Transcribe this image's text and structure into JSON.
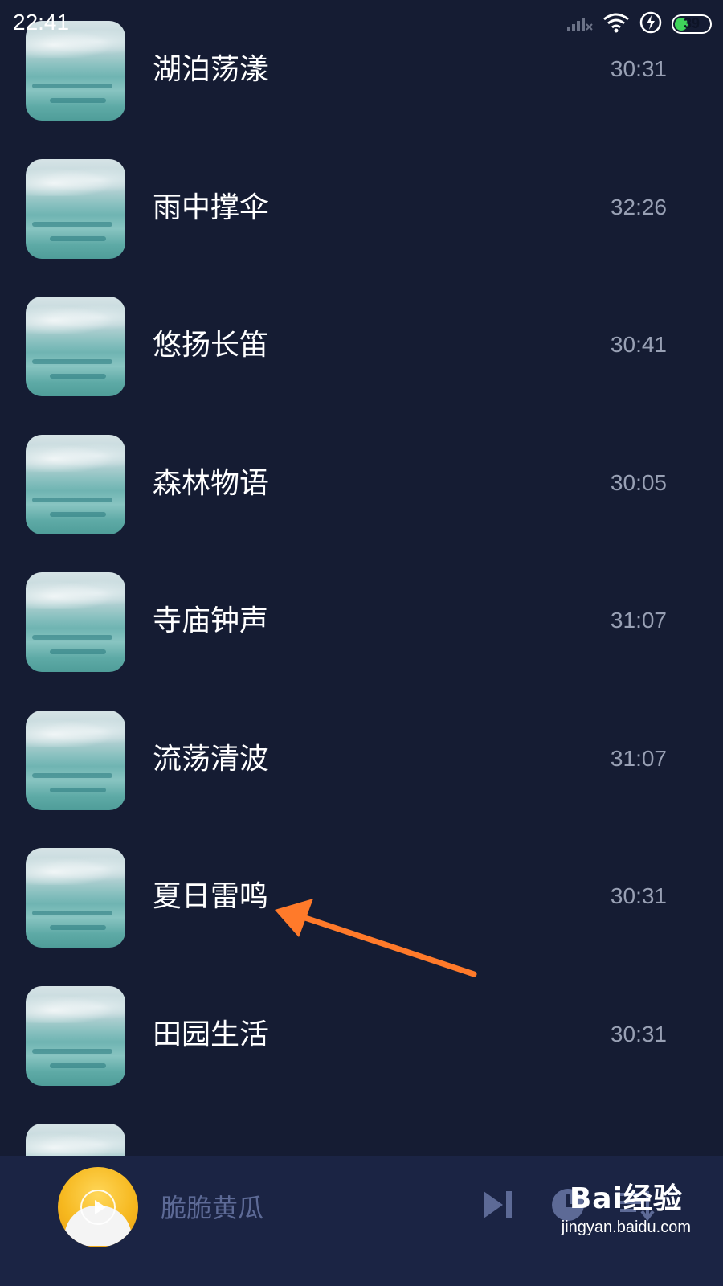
{
  "status_bar": {
    "time": "22:41",
    "battery_level": "39",
    "battery_fraction": 0.39,
    "icons": [
      "signal-icon",
      "wifi-icon",
      "charging-icon",
      "battery-icon"
    ]
  },
  "tracks": [
    {
      "title": "湖泊荡漾",
      "duration": "30:31"
    },
    {
      "title": "雨中撑伞",
      "duration": "32:26"
    },
    {
      "title": "悠扬长笛",
      "duration": "30:41"
    },
    {
      "title": "森林物语",
      "duration": "30:05"
    },
    {
      "title": "寺庙钟声",
      "duration": "31:07"
    },
    {
      "title": "流荡清波",
      "duration": "31:07"
    },
    {
      "title": "夏日雷鸣",
      "duration": "30:31"
    },
    {
      "title": "田园生活",
      "duration": "30:31"
    }
  ],
  "player": {
    "current_title": "脆脆黄瓜",
    "controls": [
      "next-icon",
      "timer-icon",
      "playlist-icon"
    ]
  },
  "annotation": {
    "color": "#ff7a2a",
    "target": "夏日雷鸣"
  },
  "watermark": {
    "logo": "Bai经验",
    "url": "jingyan.baidu.com"
  },
  "colors": {
    "background": "#151c33",
    "player_bar": "#1b2444",
    "duration_text": "#98a0b4",
    "battery_fill": "#3fd45a"
  }
}
